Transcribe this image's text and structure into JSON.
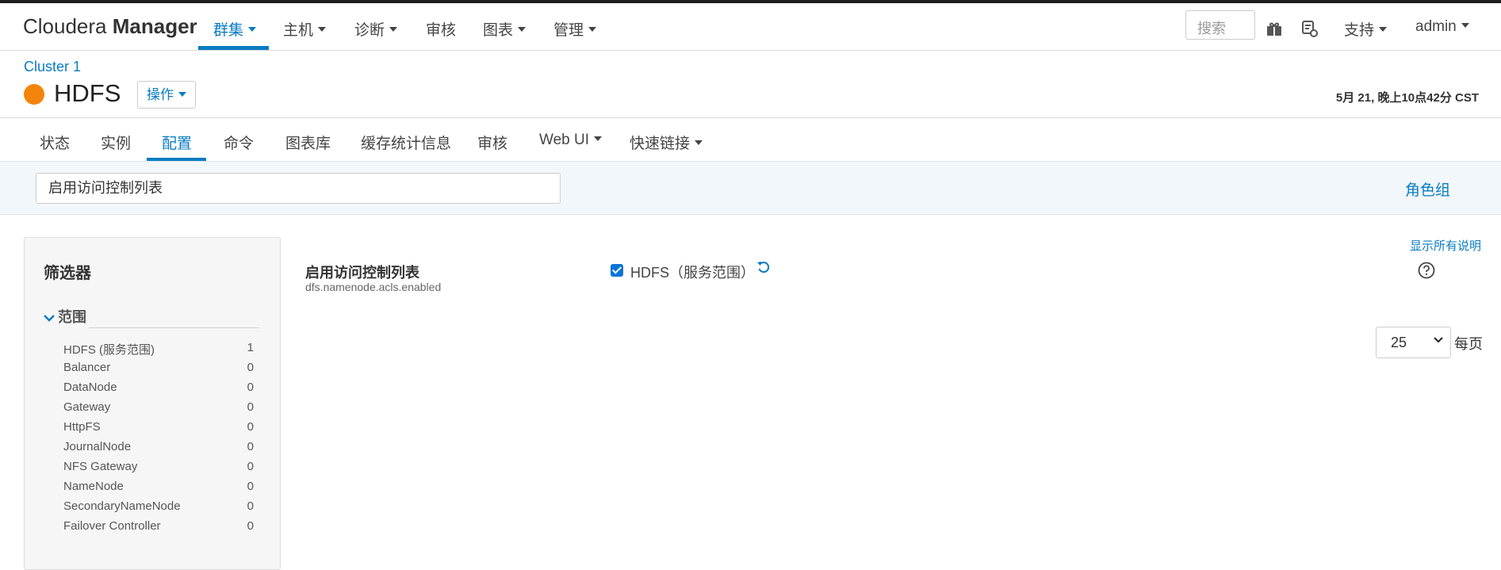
{
  "app": {
    "brand_light": "Cloudera",
    "brand_bold": "Manager"
  },
  "topnav": {
    "items": [
      {
        "label": "群集"
      },
      {
        "label": "主机"
      },
      {
        "label": "诊断"
      },
      {
        "label": "审核"
      },
      {
        "label": "图表"
      },
      {
        "label": "管理"
      }
    ],
    "active_index": 0,
    "search_placeholder": "搜索",
    "support_label": "支持",
    "user_label": "admin"
  },
  "header": {
    "cluster_link": "Cluster 1",
    "service_name": "HDFS",
    "status_color": "#f4840c",
    "actions_label": "操作",
    "timestamp": "5月 21, 晚上10点42分 CST"
  },
  "subtabs": {
    "items": [
      {
        "label": "状态"
      },
      {
        "label": "实例"
      },
      {
        "label": "配置"
      },
      {
        "label": "命令"
      },
      {
        "label": "图表库"
      },
      {
        "label": "缓存统计信息"
      },
      {
        "label": "审核"
      },
      {
        "label": "Web UI"
      },
      {
        "label": "快速链接"
      }
    ],
    "active_index": 2
  },
  "search": {
    "value": "启用访问控制列表",
    "role_group_label": "角色组"
  },
  "filters": {
    "title": "筛选器",
    "scope_label": "范围",
    "items": [
      {
        "label": "HDFS (服务范围)",
        "count": "1"
      },
      {
        "label": "Balancer",
        "count": "0"
      },
      {
        "label": "DataNode",
        "count": "0"
      },
      {
        "label": "Gateway",
        "count": "0"
      },
      {
        "label": "HttpFS",
        "count": "0"
      },
      {
        "label": "JournalNode",
        "count": "0"
      },
      {
        "label": "NFS Gateway",
        "count": "0"
      },
      {
        "label": "NameNode",
        "count": "0"
      },
      {
        "label": "SecondaryNameNode",
        "count": "0"
      },
      {
        "label": "Failover Controller",
        "count": "0"
      }
    ]
  },
  "config": {
    "show_all_desc": "显示所有说明",
    "setting_name": "启用访问控制列表",
    "property": "dfs.namenode.acls.enabled",
    "checked": true,
    "scope_label": "HDFS（服务范围）"
  },
  "pagination": {
    "per_page_value": "25",
    "per_page_label": "每页"
  },
  "colors": {
    "accent": "#0a7cc2",
    "status_orange": "#f4840c"
  }
}
